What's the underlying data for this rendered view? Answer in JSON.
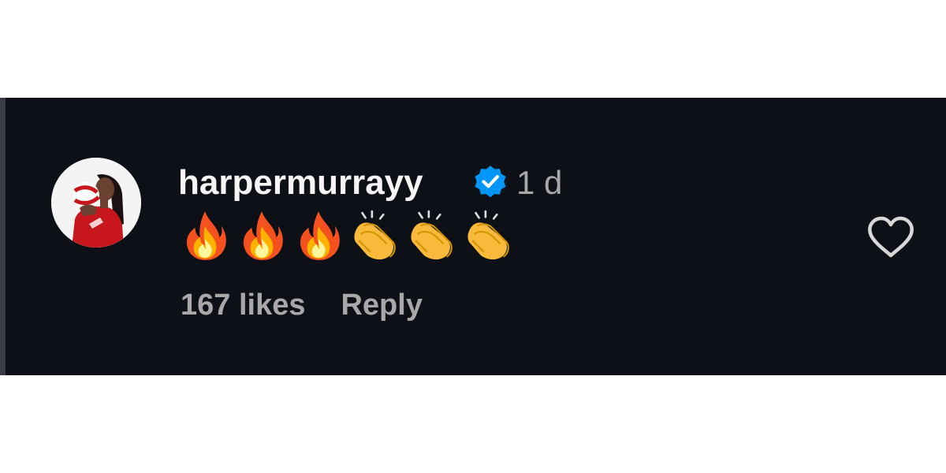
{
  "comment": {
    "username": "harpermurrayy",
    "verified": true,
    "timestamp": "1 d",
    "body_emojis": [
      "🔥",
      "🔥",
      "🔥",
      "👏",
      "👏",
      "👏"
    ],
    "likes_label": "167 likes",
    "reply_label": "Reply"
  },
  "icons": {
    "avatar": "profile-photo",
    "verified_badge": "verified-badge-icon",
    "like": "heart-outline-icon",
    "fire": "fire-emoji",
    "clap": "clapping-hands-emoji"
  },
  "colors": {
    "background": "#0d1016",
    "username": "#f5f5f5",
    "secondary_text": "#a8a8a8",
    "verified_blue": "#0095f6",
    "heart_outline": "#d8d8d8"
  }
}
